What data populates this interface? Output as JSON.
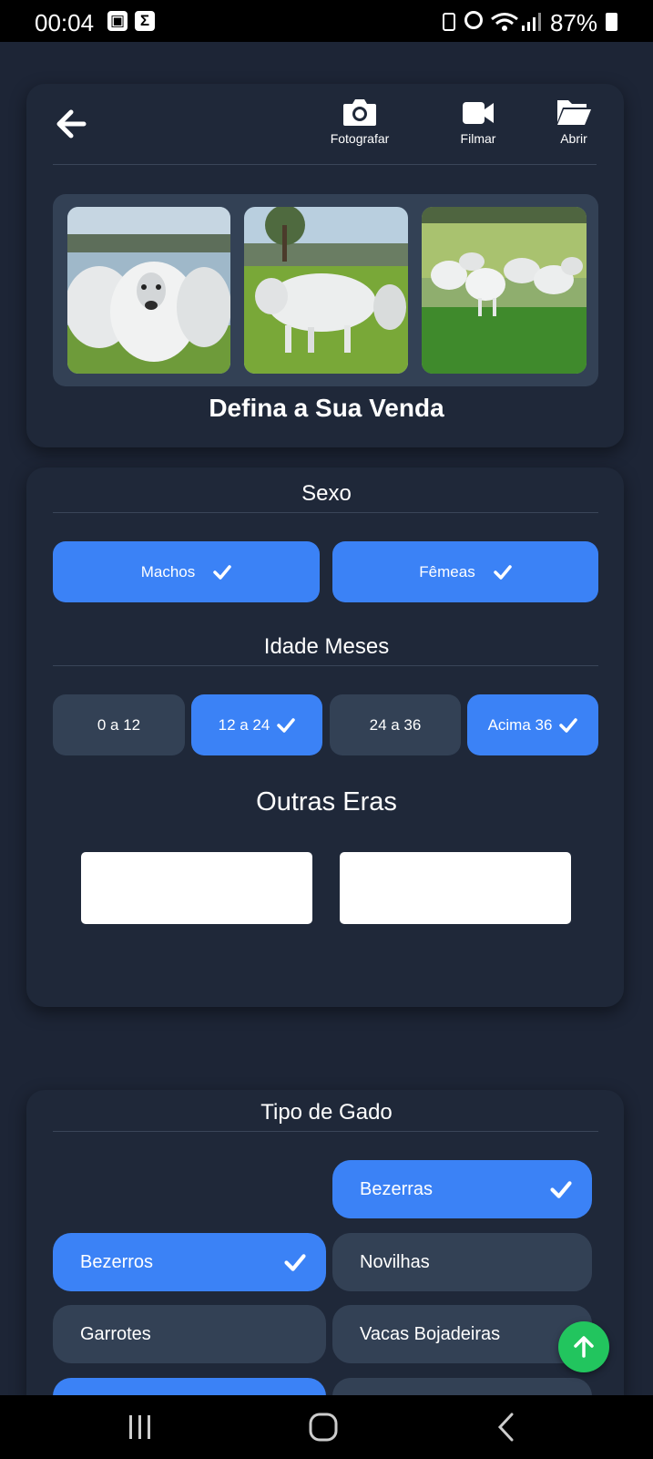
{
  "status_bar": {
    "time": "00:04",
    "battery": "87%"
  },
  "toolbar": {
    "photograph_label": "Fotografar",
    "film_label": "Filmar",
    "open_label": "Abrir"
  },
  "header": {
    "title": "Defina a Sua Venda"
  },
  "sexo": {
    "title": "Sexo",
    "options": [
      {
        "label": "Machos",
        "selected": true
      },
      {
        "label": "Fêmeas",
        "selected": true
      }
    ]
  },
  "idade": {
    "title": "Idade Meses",
    "options": [
      {
        "label": "0 a 12",
        "selected": false
      },
      {
        "label": "12 a 24",
        "selected": true
      },
      {
        "label": "24 a 36",
        "selected": false
      },
      {
        "label": "Acima 36",
        "selected": true
      }
    ]
  },
  "outras_eras": {
    "title": "Outras Eras",
    "input1_value": "",
    "input2_value": ""
  },
  "tipo_gado": {
    "title": "Tipo de Gado",
    "options": [
      {
        "label": "Bezerras",
        "selected": true
      },
      {
        "label": "Bezerros",
        "selected": true
      },
      {
        "label": "Novilhas",
        "selected": false
      },
      {
        "label": "Garrotes",
        "selected": false
      },
      {
        "label": "Vacas Bojadeiras",
        "selected": false
      }
    ]
  },
  "colors": {
    "accent": "#3b82f6",
    "unselected": "#334155",
    "fab": "#22c55e",
    "background": "#1d2536"
  },
  "icons": [
    "back-arrow-icon",
    "camera-icon",
    "video-icon",
    "folder-open-icon",
    "check-icon",
    "arrow-up-icon"
  ]
}
